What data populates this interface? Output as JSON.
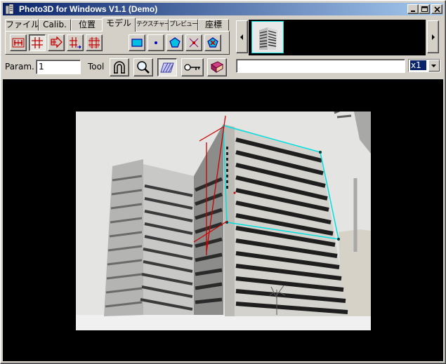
{
  "window": {
    "title": "Photo3D for Windows V1.1 (Demo)"
  },
  "tabs": [
    {
      "label": "ファイル"
    },
    {
      "label": "Calib."
    },
    {
      "label": "位置"
    },
    {
      "label": "モデル"
    },
    {
      "label": "テクスチャー"
    },
    {
      "label": "プレビュー"
    },
    {
      "label": "座標"
    }
  ],
  "active_tab": "モデル",
  "param": {
    "label": "Param.",
    "value": "1"
  },
  "tool": {
    "label": "Tool"
  },
  "status_field": {
    "value": ""
  },
  "zoom": {
    "value": "x1"
  },
  "icons": {
    "model_tools_red": [
      "dimension-line-icon",
      "grid-icon",
      "arrow-right-icon",
      "grid-arrow-icon",
      "hash-icon"
    ],
    "model_tools_blue": [
      "rectangle-icon",
      "point-icon",
      "pentagon-icon",
      "cross-point-icon",
      "pentagon-x-icon"
    ],
    "tools": [
      "magnet-icon",
      "zoom-icon",
      "hatch-icon",
      "key-icon",
      "book-icon"
    ]
  },
  "colors": {
    "title_bar": "#0a246a",
    "selection_outline": "#00e0e0",
    "guide_lines": "#cc0000",
    "viewport_bg": "#000000"
  }
}
